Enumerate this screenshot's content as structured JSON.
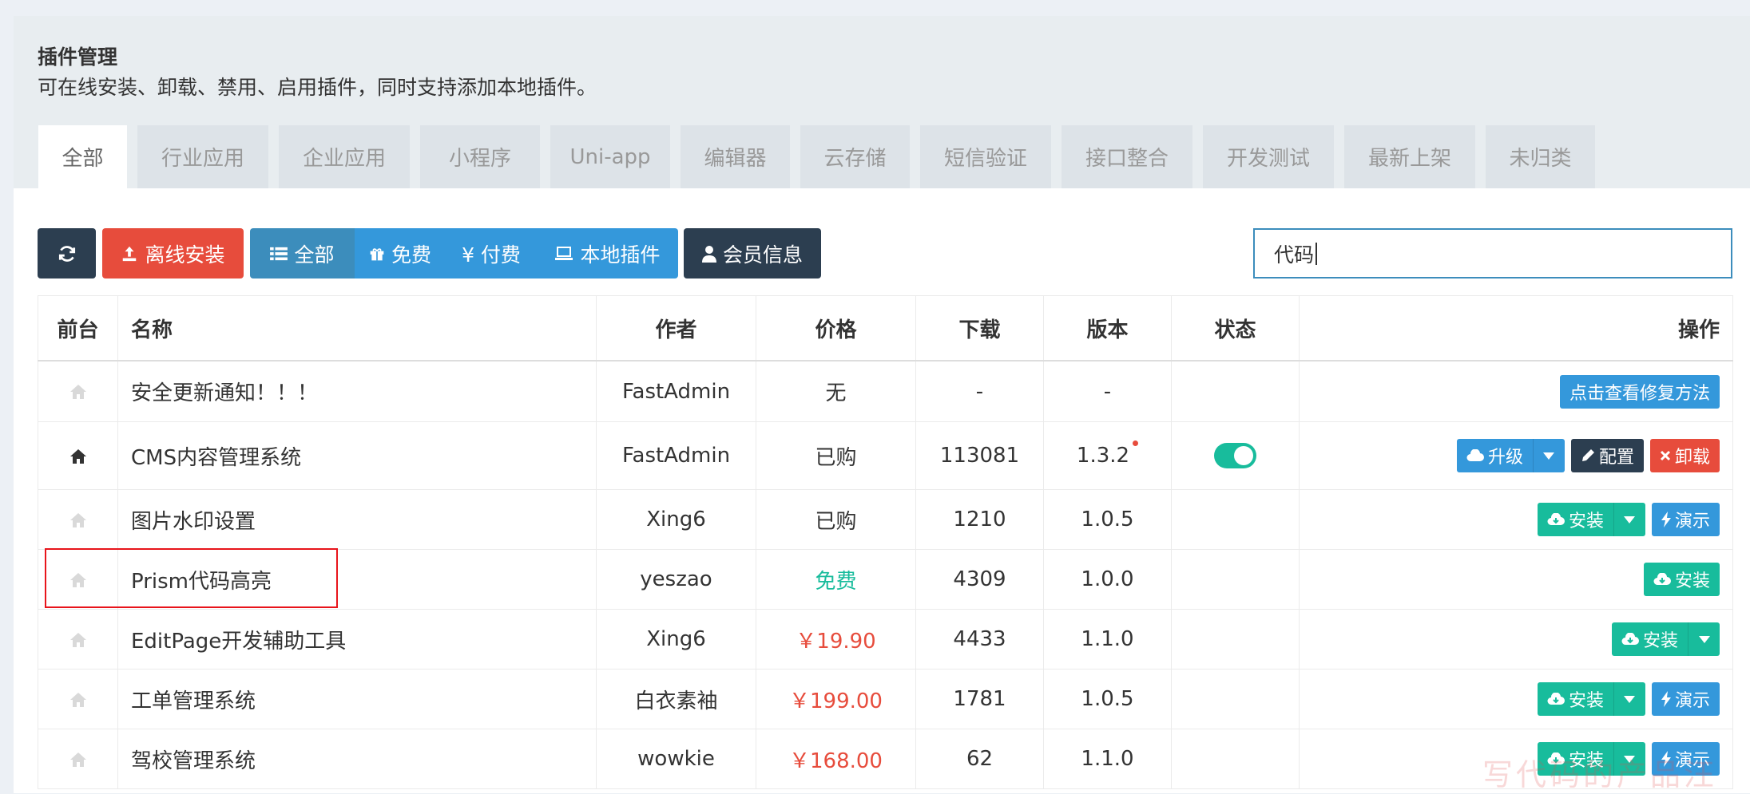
{
  "page": {
    "title": "插件管理",
    "description": "可在线安装、卸载、禁用、启用插件，同时支持添加本地插件。"
  },
  "tabs": [
    "全部",
    "行业应用",
    "企业应用",
    "小程序",
    "Uni-app",
    "编辑器",
    "云存储",
    "短信验证",
    "接口整合",
    "开发测试",
    "最新上架",
    "未归类"
  ],
  "toolbar": {
    "refresh_icon": "refresh-icon",
    "offline_install": "离线安装",
    "filter_all": "全部",
    "filter_free": "免费",
    "filter_paid": "¥ 付费",
    "filter_local": "本地插件",
    "member_info": "会员信息"
  },
  "search": {
    "value": "代码"
  },
  "table": {
    "headers": [
      "前台",
      "名称",
      "作者",
      "价格",
      "下载",
      "版本",
      "状态",
      "操作"
    ],
    "rows": [
      {
        "name": "安全更新通知！！！",
        "author": "FastAdmin",
        "price": "无",
        "downloads": "-",
        "version": "-",
        "actions": [
          "点击查看修复方法"
        ]
      },
      {
        "name": "CMS内容管理系统",
        "author": "FastAdmin",
        "price": "已购",
        "downloads": "113081",
        "version": "1.3.2",
        "status": "on",
        "actions": [
          "升级",
          "配置",
          "卸载"
        ]
      },
      {
        "name": "图片水印设置",
        "author": "Xing6",
        "price": "已购",
        "downloads": "1210",
        "version": "1.0.5",
        "actions": [
          "安装",
          "演示"
        ]
      },
      {
        "name": "Prism代码高亮",
        "author": "yeszao",
        "price": "免费",
        "downloads": "4309",
        "version": "1.0.0",
        "actions": [
          "安装"
        ]
      },
      {
        "name": "EditPage开发辅助工具",
        "author": "Xing6",
        "price": "￥19.90",
        "downloads": "4433",
        "version": "1.1.0",
        "actions": [
          "安装"
        ]
      },
      {
        "name": "工单管理系统",
        "author": "白衣素袖",
        "price": "￥199.00",
        "downloads": "1781",
        "version": "1.0.5",
        "actions": [
          "安装",
          "演示"
        ]
      },
      {
        "name": "驾校管理系统",
        "author": "wowkie",
        "price": "￥168.00",
        "downloads": "62",
        "version": "1.1.0",
        "actions": [
          "安装",
          "演示"
        ]
      }
    ]
  },
  "watermark": "写代码的产品汪",
  "colors": {
    "primary": "#3c8dbc",
    "success": "#18bc9c",
    "danger": "#e74c3c",
    "dark": "#2c3e50",
    "info": "#3498db"
  }
}
